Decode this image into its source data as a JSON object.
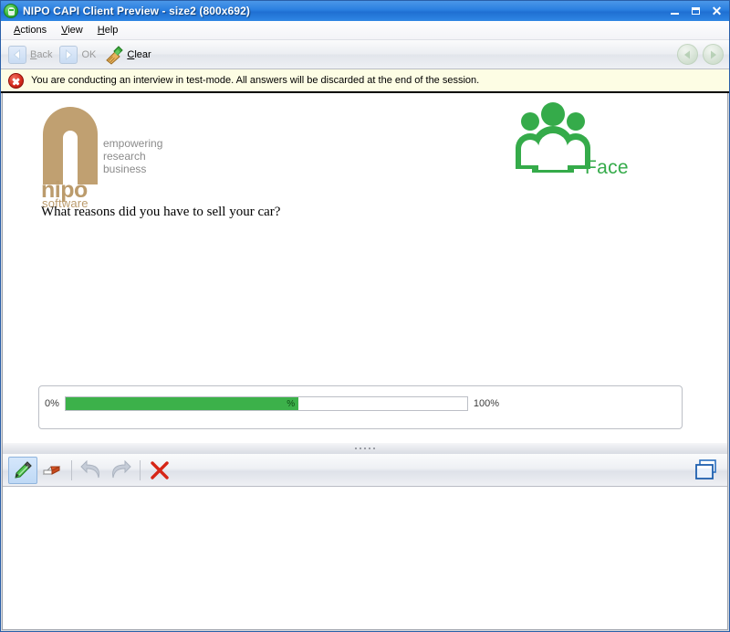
{
  "window": {
    "title": "NIPO CAPI Client Preview - size2 (800x692)",
    "app_icon": "nipo-app-icon",
    "buttons": {
      "minimize": "minimize-button",
      "maximize": "maximize-button",
      "close": "close-button"
    }
  },
  "menubar": {
    "items": [
      {
        "label": "Actions",
        "accel": "A"
      },
      {
        "label": "View",
        "accel": "V"
      },
      {
        "label": "Help",
        "accel": "H"
      }
    ]
  },
  "toolbar": {
    "back_label": "Back",
    "back_accel": "B",
    "ok_label": "OK",
    "clear_label": "Clear",
    "clear_accel": "C",
    "back_icon": "chevron-left-icon",
    "ok_icon": "chevron-right-icon",
    "clear_icon": "broom-icon",
    "nav_prev_icon": "circle-arrow-left-icon",
    "nav_next_icon": "circle-arrow-right-icon"
  },
  "warning": {
    "icon": "error-circle-icon",
    "text": "You are conducting an interview in test-mode. All answers will be discarded at the end of the session."
  },
  "branding": {
    "nipo": {
      "logo_mark": "nipo-n-mark",
      "name": "nipo",
      "subtitle": "software",
      "tagline_line1": "empowering",
      "tagline_line2": "research",
      "tagline_line3": "business",
      "color": "#bb9b6c"
    },
    "face": {
      "icon": "people-group-icon",
      "label": "Face",
      "color": "#35ab4a"
    }
  },
  "question": {
    "text": "What reasons did you have to sell your car?"
  },
  "progress": {
    "min_label": "0%",
    "max_label": "100%",
    "value_label": "%",
    "value_percent": 58,
    "fill_color": "#3cb14a"
  },
  "splitter": {
    "grip": "splitter-grip"
  },
  "drawing_toolbar": {
    "tools": [
      {
        "name": "pen-tool",
        "icon": "pen-icon",
        "active": true
      },
      {
        "name": "eraser-tool",
        "icon": "eraser-icon",
        "active": false
      },
      {
        "name": "undo-tool",
        "icon": "undo-arrow-icon",
        "active": false,
        "disabled": true
      },
      {
        "name": "redo-tool",
        "icon": "redo-arrow-icon",
        "active": false,
        "disabled": true
      },
      {
        "name": "delete-tool",
        "icon": "red-x-icon",
        "active": false
      }
    ],
    "right_tool": {
      "name": "cascade-windows-tool",
      "icon": "cascade-windows-icon"
    }
  }
}
